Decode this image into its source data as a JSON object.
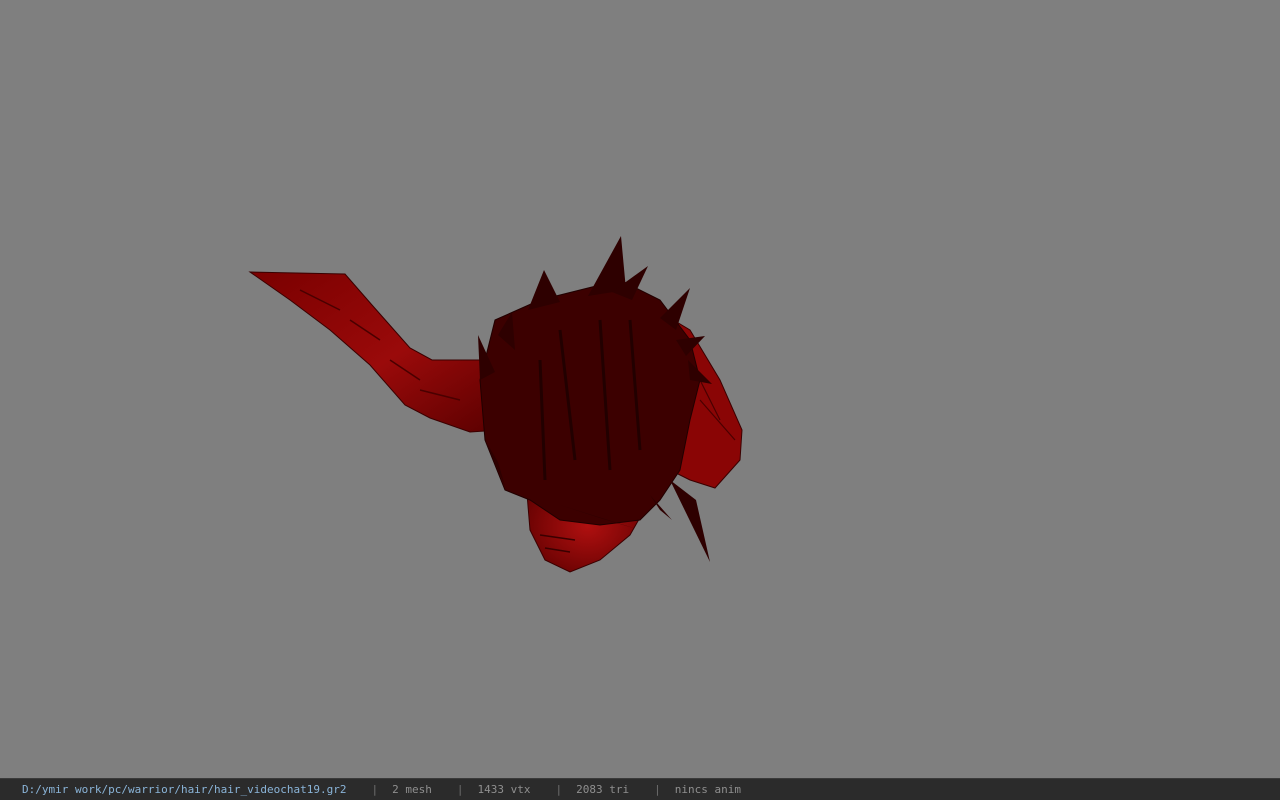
{
  "status_bar": {
    "file_path": "D:/ymir work/pc/warrior/hair/hair_videochat19.gr2",
    "separator": "|",
    "mesh_count": "2 mesh",
    "vertex_count": "1433 vtx",
    "triangle_count": "2083 tri",
    "animation": "nincs anim"
  },
  "viewport": {
    "background_color": "#7f7f7f",
    "model_color": "#8a0000"
  }
}
